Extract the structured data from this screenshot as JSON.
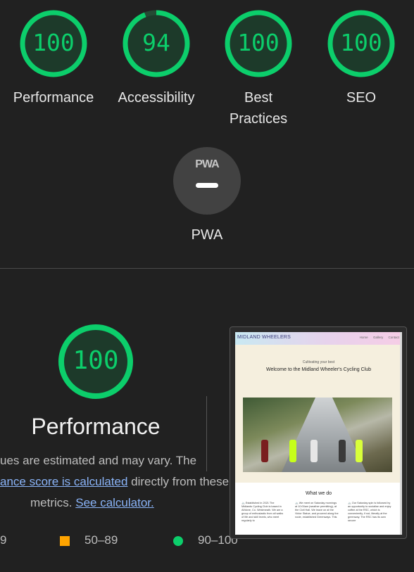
{
  "categories": [
    {
      "label": "Performance",
      "score": "100",
      "value": 100
    },
    {
      "label": "Accessibility",
      "score": "94",
      "value": 94
    },
    {
      "label": "Best\nPractices",
      "score": "100",
      "value": 100
    },
    {
      "label": "SEO",
      "score": "100",
      "value": 100
    }
  ],
  "pwa": {
    "logo": "PWA",
    "label": "PWA"
  },
  "detail": {
    "score": "100",
    "value": 100,
    "title": "Performance",
    "desc_line1": "ues are estimated and may vary. The",
    "desc_link1": "ance score is calculated",
    "desc_line2_rest": " directly from these",
    "desc_line3": "metrics. ",
    "desc_link2": "See calculator."
  },
  "legend": {
    "fail": "9",
    "average": "50–89",
    "pass": "90–100"
  },
  "colors": {
    "pass": "#0cce6b",
    "average": "#ffa400",
    "background": "#212121",
    "link": "#8ab4f8"
  },
  "screenshot": {
    "brand": "MIDLAND WHEELERS",
    "nav": [
      "Home",
      "Gallery",
      "Contact"
    ],
    "tagline": "Cultivating your best",
    "welcome": "Welcome to the Midland Wheeler's Cycling Club",
    "section_title": "What we do",
    "col1": "🚲 Established in 2021 The Midlands Cycling Club is based in Athlone, Co. Westmeath. We are a group of enthusiastic from all walks of life and skill levels, who meet regularly to",
    "col2": "🚲 We meet on Saturday mornings at 10:00am (weather permitting), at the Civil Hall. We leave on at the Victor Statue, and proceed along the route, established Greenways. This",
    "col3": "🚲 Our Saturday spin is followed by an opportunity to socialise and enjoy coffee at the RSC, which is conveniently, if not, literally at the greenway. The RSC has its own secure"
  }
}
